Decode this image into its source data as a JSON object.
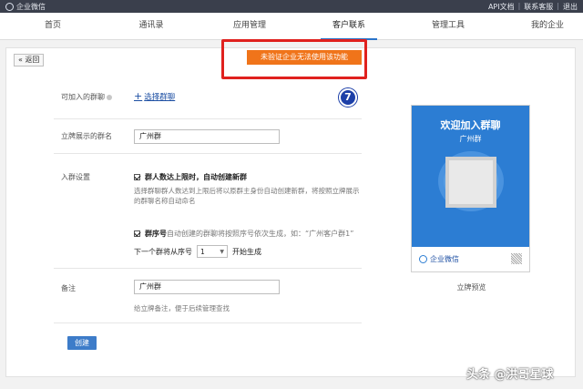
{
  "topbar": {
    "brand": "企业微信",
    "links": [
      "API文档",
      "联系客服",
      "退出"
    ],
    "separator": "|"
  },
  "nav": {
    "tabs": [
      "首页",
      "通讯录",
      "应用管理",
      "客户联系",
      "管理工具",
      "我的企业"
    ],
    "active": 3
  },
  "back_label": "« 返回",
  "warning_label": "未验证企业无法使用该功能",
  "badge": "7",
  "form": {
    "group_label": "可加入的群聊",
    "select_group_label": "选择群聊",
    "display_name_label": "立牌展示的群名",
    "display_name_value": "广州群",
    "join_settings_label": "入群设置",
    "auto_create_label": "群人数达上限时，自动创建新群",
    "auto_create_desc": "选择群聊群人数达到上限后将以原群主身份自动创建新群，将按照立牌展示的群聊名称自动命名",
    "seq_bold": "群序号",
    "seq_desc": "自动创建的群聊将按照序号依次生成，如：“广州客户群1”",
    "next_group_prefix": "下一个群将从序号",
    "next_group_value": "1",
    "next_group_suffix": "开始生成",
    "remark_label": "备注",
    "remark_value": "广州群",
    "remark_hint": "给立牌备注，便于后续管理查找",
    "create_button": "创建"
  },
  "preview": {
    "title": "欢迎加入群聊",
    "subtitle": "广州群",
    "footer_brand": "企业微信",
    "caption": "立牌预览"
  },
  "watermark": "头条 @洪哥星球",
  "colors": {
    "topbar": "#3a3f4c",
    "accent": "#2c7dd3",
    "warning": "#f0741a",
    "highlight_box": "#e0211e",
    "badge": "#1c3fa8"
  }
}
